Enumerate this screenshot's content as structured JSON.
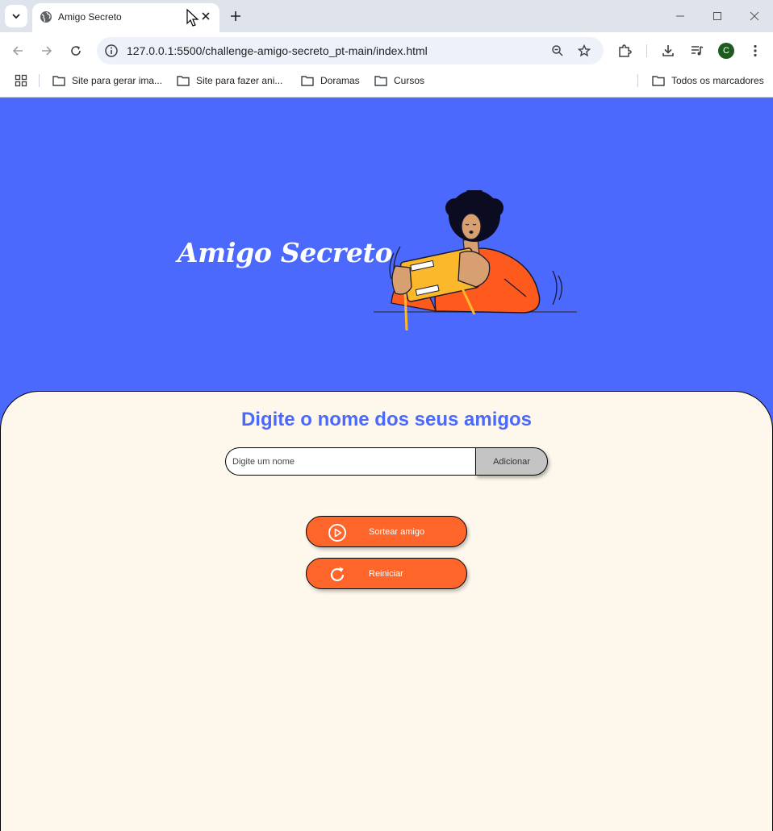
{
  "browser": {
    "tab_title": "Amigo Secreto",
    "url": "127.0.0.1:5500/challenge-amigo-secreto_pt-main/index.html",
    "avatar_letter": "C",
    "bookmarks": [
      "Site para gerar ima...",
      "Site para fazer ani...",
      "Doramas",
      "Cursos"
    ],
    "all_bookmarks": "Todos os marcadores"
  },
  "page": {
    "banner_title": "Amigo Secreto",
    "section_title": "Digite o nome dos seus amigos",
    "name_input_placeholder": "Digite um nome",
    "add_button": "Adicionar",
    "draw_button": "Sortear amigo",
    "reset_button": "Reiniciar"
  },
  "colors": {
    "banner_blue": "#4b69fd",
    "panel_cream": "#fef8ec",
    "button_orange": "#fe652b",
    "add_button_gray": "#c4c4c4"
  }
}
